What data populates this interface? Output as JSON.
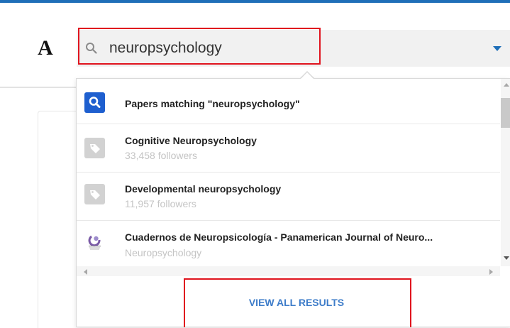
{
  "colors": {
    "brand_blue": "#1f6fb8",
    "highlight_red": "#e0141e",
    "link_blue": "#3d7cc9",
    "result_icon_blue": "#1e5fcf",
    "tag_grey": "#d2d2d2"
  },
  "header": {
    "logo_letter": "A",
    "search": {
      "value": "neuropsychology",
      "icon": "search-icon",
      "dropdown_icon": "caret-down-icon"
    }
  },
  "dropdown": {
    "results": [
      {
        "icon": "search-icon",
        "title": "Papers matching \"neuropsychology\"",
        "subtitle": ""
      },
      {
        "icon": "tag-icon",
        "title": "Cognitive Neuropsychology",
        "subtitle": "33,458 followers"
      },
      {
        "icon": "tag-icon",
        "title": "Developmental neuropsychology",
        "subtitle": "11,957 followers"
      },
      {
        "icon": "journal-logo",
        "title": "Cuadernos de Neuropsicología - Panamerican Journal of Neuro...",
        "subtitle": "Neuropsychology"
      }
    ],
    "view_all_label": "VIEW ALL RESULTS"
  }
}
